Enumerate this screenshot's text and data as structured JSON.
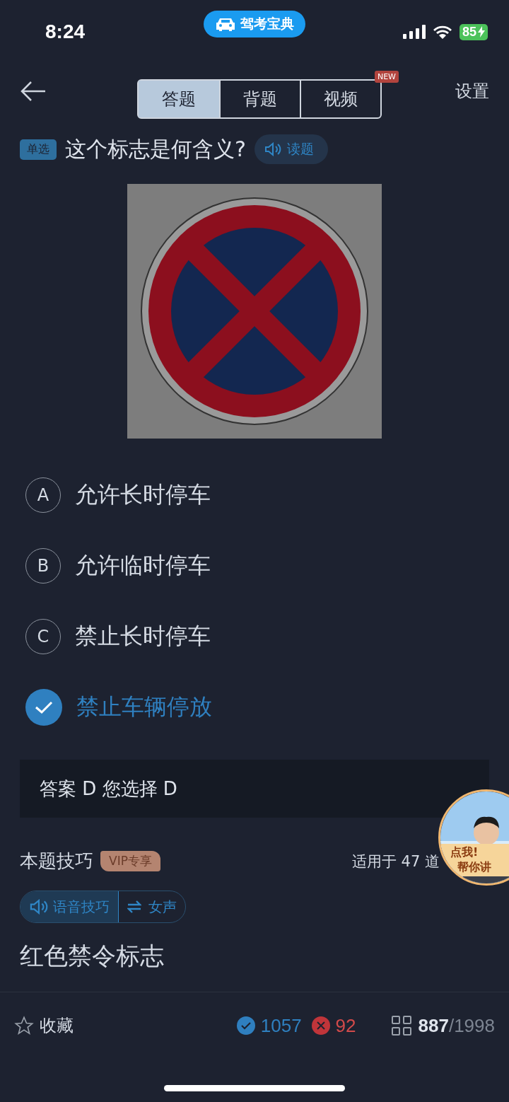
{
  "status_bar": {
    "time": "8:24",
    "app_pill": "驾考宝典",
    "battery": "85"
  },
  "nav": {
    "tabs": [
      {
        "label": "答题",
        "selected": true
      },
      {
        "label": "背题",
        "selected": false
      },
      {
        "label": "视频",
        "selected": false,
        "badge": "NEW"
      }
    ],
    "settings": "设置"
  },
  "question": {
    "type_tag": "单选",
    "text": "这个标志是何含义?",
    "read_button": "读题"
  },
  "options": [
    {
      "letter": "A",
      "text": "允许长时停车",
      "selected": false
    },
    {
      "letter": "B",
      "text": "允许临时停车",
      "selected": false
    },
    {
      "letter": "C",
      "text": "禁止长时停车",
      "selected": false
    },
    {
      "text": "禁止车辆停放",
      "selected": true
    }
  ],
  "answer": "答案 D 您选择 D",
  "tips": {
    "title": "本题技巧",
    "vip_tag": "VIP专享",
    "applies": "适用于 47 道",
    "voice_button": "语音技巧",
    "switch_button": "女声",
    "content": "红色禁令标志"
  },
  "helper_bubble": {
    "line_1": "点我!",
    "line_2": "帮你讲"
  },
  "bottom_bar": {
    "favorite": "收藏",
    "correct": "1057",
    "wrong": "92",
    "current": "887",
    "total": "/1998"
  }
}
